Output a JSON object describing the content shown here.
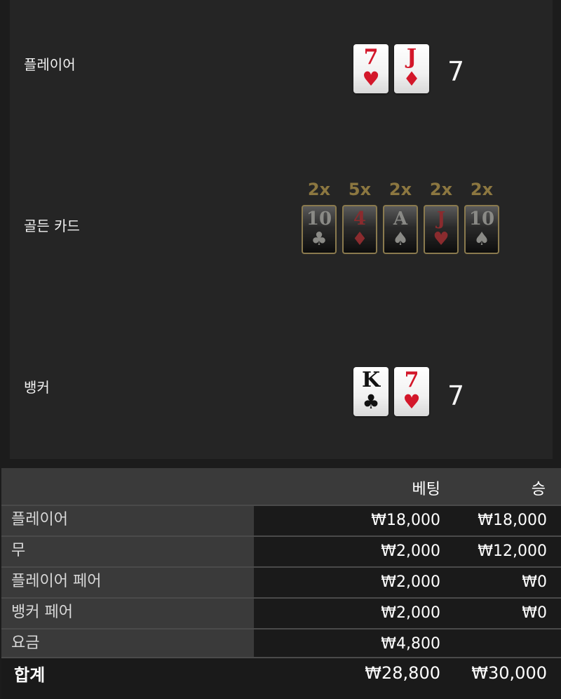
{
  "result": {
    "player": {
      "label": "플레이어",
      "cards": [
        {
          "rank": "7",
          "suit": "♥",
          "color": "red"
        },
        {
          "rank": "J",
          "suit": "♦",
          "color": "red"
        }
      ],
      "total": "7"
    },
    "golden": {
      "label": "골든 카드",
      "cards": [
        {
          "mult": "2x",
          "rank": "10",
          "suit": "♣",
          "color": "black"
        },
        {
          "mult": "5x",
          "rank": "4",
          "suit": "♦",
          "color": "red"
        },
        {
          "mult": "2x",
          "rank": "A",
          "suit": "♠",
          "color": "black"
        },
        {
          "mult": "2x",
          "rank": "J",
          "suit": "♥",
          "color": "red"
        },
        {
          "mult": "2x",
          "rank": "10",
          "suit": "♠",
          "color": "black"
        }
      ]
    },
    "banker": {
      "label": "뱅커",
      "cards": [
        {
          "rank": "K",
          "suit": "♣",
          "color": "black"
        },
        {
          "rank": "7",
          "suit": "♥",
          "color": "red"
        }
      ],
      "total": "7"
    }
  },
  "table": {
    "headers": {
      "bet": "베팅",
      "win": "승"
    },
    "rows": [
      {
        "label": "플레이어",
        "bet": "₩18,000",
        "win": "₩18,000"
      },
      {
        "label": "무",
        "bet": "₩2,000",
        "win": "₩12,000"
      },
      {
        "label": "플레이어 페어",
        "bet": "₩2,000",
        "win": "₩0"
      },
      {
        "label": "뱅커 페어",
        "bet": "₩2,000",
        "win": "₩0"
      },
      {
        "label": "요금",
        "bet": "₩4,800",
        "win": ""
      }
    ],
    "total": {
      "label": "합계",
      "bet": "₩28,800",
      "win": "₩30,000"
    }
  },
  "colors": {
    "card_red": "#d3172a",
    "gold_multiplier": "#8c7740",
    "panel_bg": "#252525",
    "header_bg": "#3a3a3a"
  }
}
